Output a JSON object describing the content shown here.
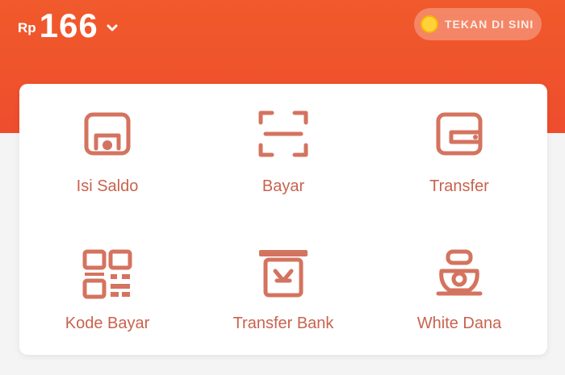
{
  "header": {
    "balance": {
      "currency": "Rp",
      "amount": "166"
    },
    "promo": {
      "label": "TEKAN DI SINI",
      "icon": "coin-icon"
    }
  },
  "colors": {
    "primary": "#ee4d2d",
    "icon": "#d4735f",
    "label": "#c8634e"
  },
  "menu": [
    {
      "label": "Isi Saldo",
      "icon": "top-up-icon"
    },
    {
      "label": "Bayar",
      "icon": "scan-icon"
    },
    {
      "label": "Transfer",
      "icon": "wallet-icon"
    },
    {
      "label": "Kode Bayar",
      "icon": "qr-code-icon"
    },
    {
      "label": "Transfer Bank",
      "icon": "bank-icon"
    },
    {
      "label": "White Dana",
      "icon": "piggy-bank-icon"
    }
  ]
}
